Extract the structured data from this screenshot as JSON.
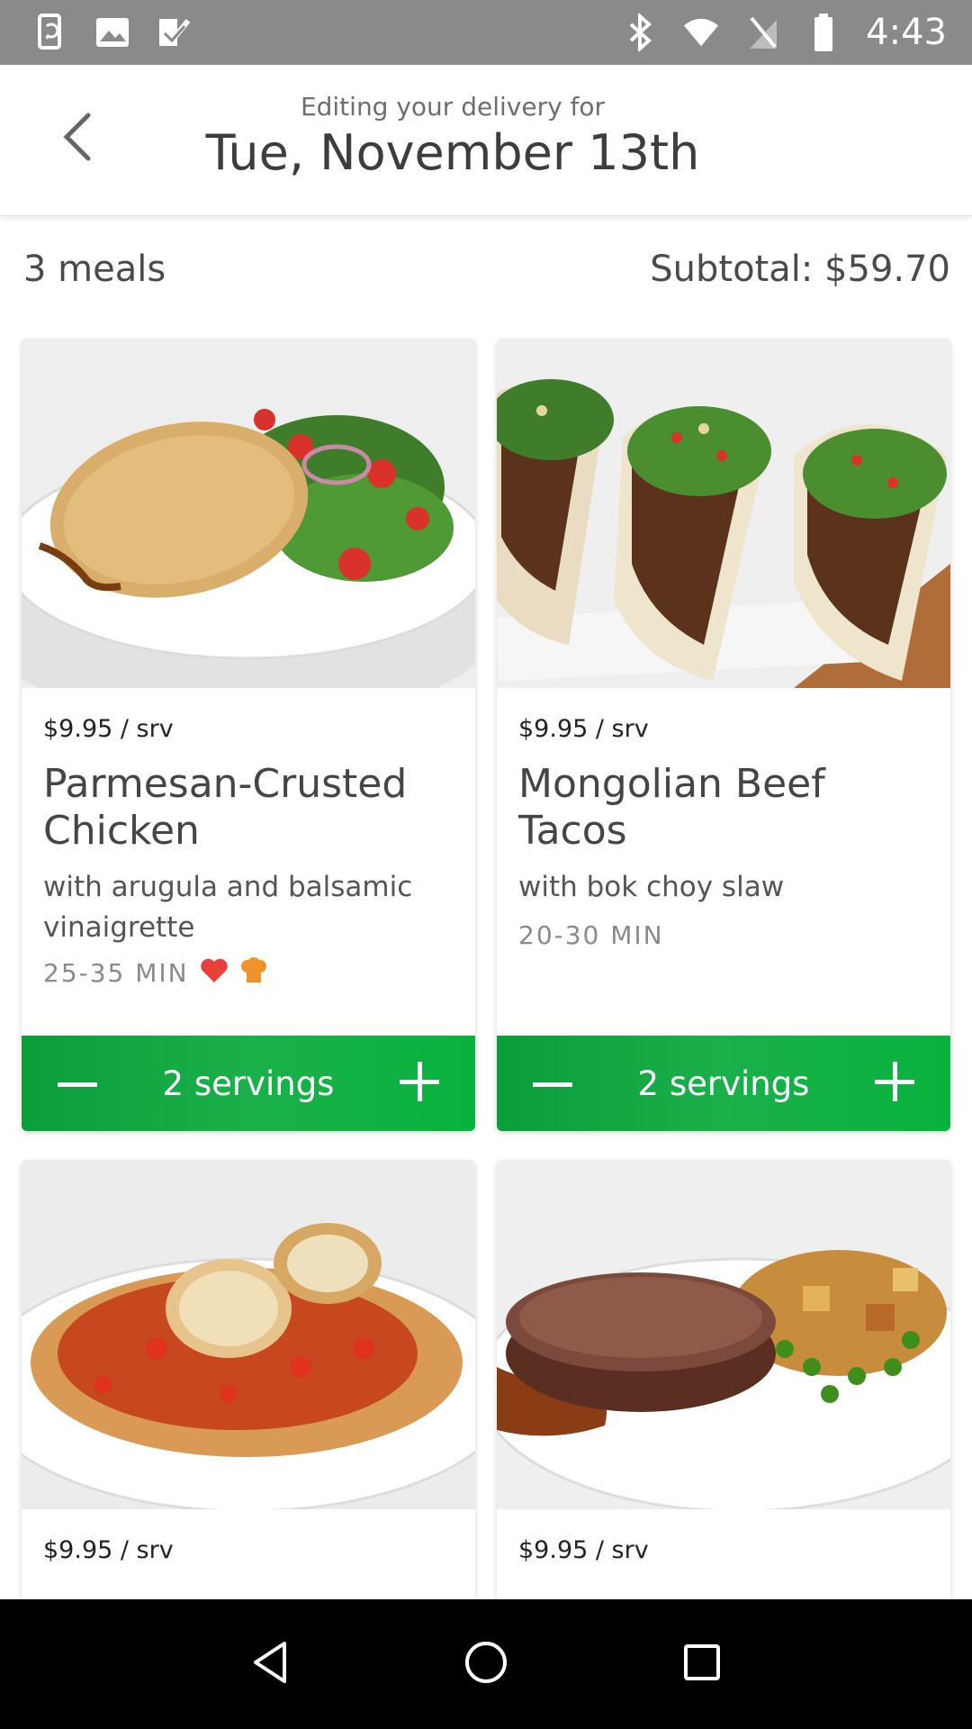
{
  "status_bar": {
    "time": "4:43",
    "left_icons": [
      "phone-sync-icon",
      "image-icon",
      "task-check-icon"
    ],
    "right_icons": [
      "bluetooth-icon",
      "wifi-icon",
      "no-sim-icon",
      "battery-icon"
    ]
  },
  "header": {
    "subtitle": "Editing your delivery for",
    "title": "Tue, November 13th",
    "back_icon": "chevron-left-icon"
  },
  "summary": {
    "meals_count": "3 meals",
    "subtotal": "Subtotal: $59.70"
  },
  "colors": {
    "accent_green": "#0aa53d",
    "heart": "#e8413c",
    "chef": "#f0932b"
  },
  "meals": [
    {
      "price": "$9.95 / srv",
      "name": "Parmesan-Crusted Chicken",
      "description": "with arugula and balsamic vinaigrette",
      "time": "25-35 MIN",
      "badges": [
        "heart-icon",
        "chef-hat-icon"
      ],
      "servings": "2 servings"
    },
    {
      "price": "$9.95 / srv",
      "name": "Mongolian Beef Tacos",
      "description": "with bok choy slaw",
      "time": "20-30 MIN",
      "servings": "2 servings"
    },
    {
      "price": "$9.95 / srv"
    },
    {
      "price": "$9.95 / srv"
    }
  ],
  "nav": [
    "back-triangle-icon",
    "home-circle-icon",
    "recents-square-icon"
  ]
}
